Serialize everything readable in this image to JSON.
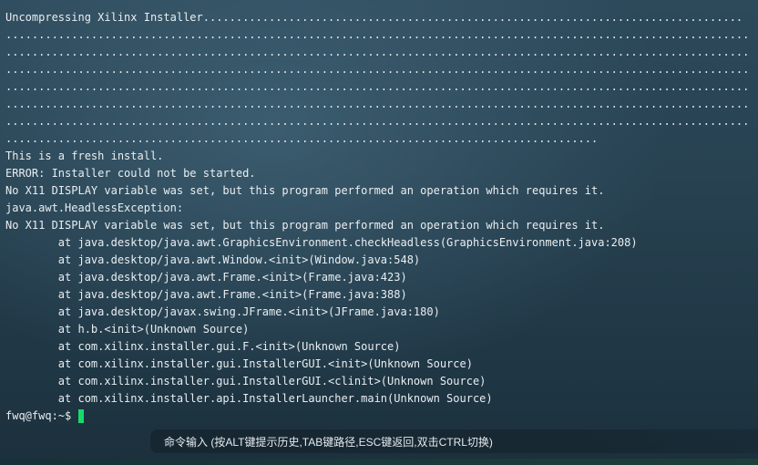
{
  "terminal": {
    "lines": [
      "Uncompressing Xilinx Installer..................................................................................",
      ".................................................................................................................",
      ".................................................................................................................",
      ".................................................................................................................",
      ".................................................................................................................",
      ".................................................................................................................",
      ".................................................................................................................",
      "..........................................................................................",
      "This is a fresh install.",
      "ERROR: Installer could not be started.",
      "No X11 DISPLAY variable was set, but this program performed an operation which requires it.",
      "java.awt.HeadlessException:",
      "No X11 DISPLAY variable was set, but this program performed an operation which requires it.",
      "        at java.desktop/java.awt.GraphicsEnvironment.checkHeadless(GraphicsEnvironment.java:208)",
      "        at java.desktop/java.awt.Window.<init>(Window.java:548)",
      "        at java.desktop/java.awt.Frame.<init>(Frame.java:423)",
      "        at java.desktop/java.awt.Frame.<init>(Frame.java:388)",
      "        at java.desktop/javax.swing.JFrame.<init>(JFrame.java:180)",
      "        at h.b.<init>(Unknown Source)",
      "        at com.xilinx.installer.gui.F.<init>(Unknown Source)",
      "        at com.xilinx.installer.gui.InstallerGUI.<init>(Unknown Source)",
      "        at com.xilinx.installer.gui.InstallerGUI.<clinit>(Unknown Source)",
      "        at com.xilinx.installer.api.InstallerLauncher.main(Unknown Source)"
    ],
    "prompt": "fwq@fwq:~$"
  },
  "command_bar": {
    "label": "命令输入 (按ALT键提示历史,TAB键路径,ESC键返回,双击CTRL切换)"
  },
  "colors": {
    "background": "#26404f",
    "text": "#e9eef1",
    "cursor": "#19d96b"
  }
}
